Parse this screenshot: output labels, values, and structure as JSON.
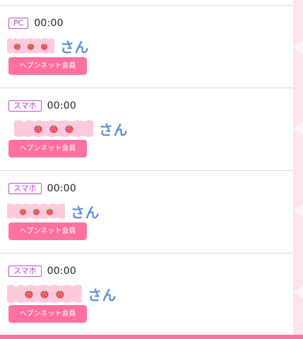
{
  "entries": [
    {
      "device": "PC",
      "time": "00:00",
      "honorific": "さん",
      "button": "ヘブンネット会員"
    },
    {
      "device": "スマホ",
      "time": "00:00",
      "honorific": "さん",
      "button": "ヘブンネット会員"
    },
    {
      "device": "スマホ",
      "time": "00:00",
      "honorific": "さん",
      "button": "ヘブンネット会員"
    },
    {
      "device": "スマホ",
      "time": "00:00",
      "honorific": "さん",
      "button": "ヘブンネット会員"
    }
  ],
  "colors": {
    "badge_border": "#c24bd0",
    "badge_text": "#b73ac8",
    "honorific": "#5d8fd6",
    "button_bg": "#ff6fa2",
    "tape": "#ffc9dd",
    "sidebar": "#ffe3ec",
    "divider": "#d9d9d9"
  },
  "icons": {
    "name_mark": "strawberry-icon"
  }
}
